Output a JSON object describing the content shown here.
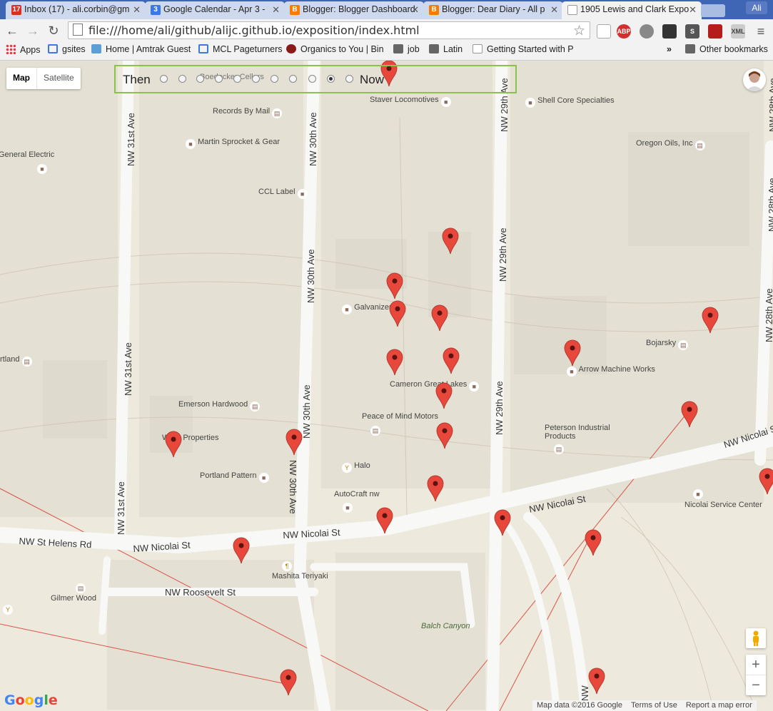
{
  "tabs": [
    {
      "label": "Inbox (17) - ali.corbin@gm",
      "icon": "gmail-icon",
      "badge": "17",
      "color": "#d93025"
    },
    {
      "label": "Google Calendar - Apr 3 -",
      "icon": "calendar-icon",
      "badge": "3",
      "color": "#3b78e7"
    },
    {
      "label": "Blogger: Blogger Dashboard",
      "icon": "blogger-icon",
      "badge": "B",
      "color": "#f57c00"
    },
    {
      "label": "Blogger: Dear Diary - All p",
      "icon": "blogger-icon",
      "badge": "B",
      "color": "#f57c00"
    },
    {
      "label": "1905 Lewis and Clark Expo",
      "icon": "page-icon",
      "badge": "",
      "color": "#ffffff"
    }
  ],
  "profile_label": "Ali",
  "address": "file:///home/ali/github/alijc.github.io/exposition/index.html",
  "bookmarks": [
    {
      "label": "Apps",
      "icon": "apps-grid-icon"
    },
    {
      "label": "gsites",
      "icon": "sites-icon"
    },
    {
      "label": "Home | Amtrak Guest",
      "icon": "amtrak-icon"
    },
    {
      "label": "MCL Pageturners",
      "icon": "sites-icon"
    },
    {
      "label": "Organics to You | Bin",
      "icon": "organics-icon"
    },
    {
      "label": "job",
      "icon": "folder-icon"
    },
    {
      "label": "Latin",
      "icon": "folder-icon"
    },
    {
      "label": "Getting Started with P",
      "icon": "page-icon"
    }
  ],
  "bookmarks_overflow": "»",
  "other_bookmarks": "Other bookmarks",
  "map": {
    "map_button": "Map",
    "satellite_button": "Satellite",
    "slider_left": "Then",
    "slider_right": "Now",
    "slider_positions": 11,
    "slider_selected": 9,
    "places": [
      {
        "name": "Records By Mail",
        "icon": "shopping-icon"
      },
      {
        "name": "Staver Locomotives",
        "icon": "place-icon"
      },
      {
        "name": "Shell Core Specialties",
        "icon": "place-icon"
      },
      {
        "name": "Martin Sprocket & Gear",
        "icon": "place-icon"
      },
      {
        "name": "General Electric",
        "icon": "place-icon"
      },
      {
        "name": "Oregon Oils, Inc",
        "icon": "shopping-icon"
      },
      {
        "name": "CCL Label",
        "icon": "place-icon"
      },
      {
        "name": "Galvanizers",
        "icon": "place-icon"
      },
      {
        "name": "Bojarsky",
        "icon": "shopping-icon"
      },
      {
        "name": "rtland",
        "icon": "shopping-icon"
      },
      {
        "name": "Arrow Machine Works",
        "icon": "place-icon"
      },
      {
        "name": "Cameron Great Lakes",
        "icon": "place-icon"
      },
      {
        "name": "Emerson Hardwood",
        "icon": "shopping-icon"
      },
      {
        "name": "Peace of Mind Motors",
        "icon": "shopping-icon"
      },
      {
        "name": "WDC Properties",
        "icon": "place-icon"
      },
      {
        "name": "Peterson Industrial Products",
        "icon": "shopping-icon"
      },
      {
        "name": "Portland Pattern",
        "icon": "place-icon"
      },
      {
        "name": "Halo",
        "icon": "bar-icon"
      },
      {
        "name": "AutoCraft nw",
        "icon": "place-icon"
      },
      {
        "name": "Nicolai Service Center",
        "icon": "place-icon"
      },
      {
        "name": "Mashita Teriyaki",
        "icon": "restaurant-icon"
      },
      {
        "name": "Gilmer Wood",
        "icon": "shopping-icon"
      },
      {
        "name": "Balch Canyon",
        "icon": "park-icon"
      },
      {
        "name": "Boedecker Cellars",
        "icon": "place-icon"
      }
    ],
    "streets": [
      "NW 31st Ave",
      "NW 30th Ave",
      "NW 29th Ave",
      "NW 28th Ave",
      "NW Nicolai St",
      "NW St Helens Rd",
      "NW Roosevelt St",
      "NW"
    ],
    "marker_count": 22,
    "marker_color": "#e8483c",
    "zoom_in": "+",
    "zoom_out": "−",
    "google_logo": "Google",
    "footer": [
      "Map data ©2016 Google",
      "Terms of Use",
      "Report a map error"
    ]
  }
}
